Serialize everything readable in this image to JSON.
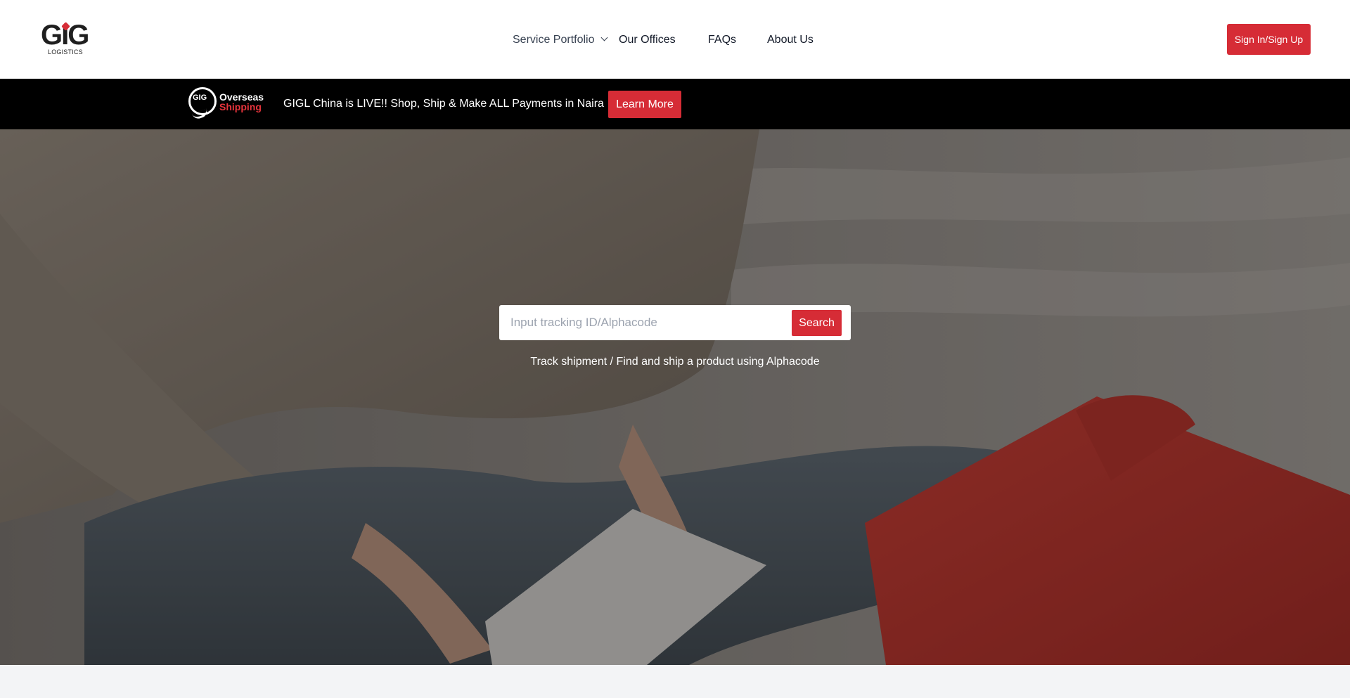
{
  "brand": {
    "logo_mark": "GIG",
    "logo_sub": "LOGISTICS"
  },
  "nav": {
    "service_portfolio": "Service Portfolio",
    "our_offices": "Our Offices",
    "faqs": "FAQs",
    "about_us": "About Us",
    "sign_in": "Sign In/Sign Up"
  },
  "promo": {
    "badge_globe": "GIG",
    "badge_line1": "Overseas",
    "badge_line2": "Shipping",
    "message": "GIGL China is LIVE!! Shop, Ship & Make ALL Payments in Naira",
    "cta": "Learn More"
  },
  "hero": {
    "search_placeholder": "Input tracking ID/Alphacode",
    "search_button": "Search",
    "helper_text": "Track shipment / Find and ship a product using Alphacode"
  },
  "colors": {
    "accent": "#d62c36",
    "banner_bg": "#000000",
    "header_bg": "#ffffff",
    "page_bg": "#f3f4f6"
  },
  "icons": {
    "dropdown": "chevron-down-icon",
    "promo_badge": "globe-icon"
  }
}
